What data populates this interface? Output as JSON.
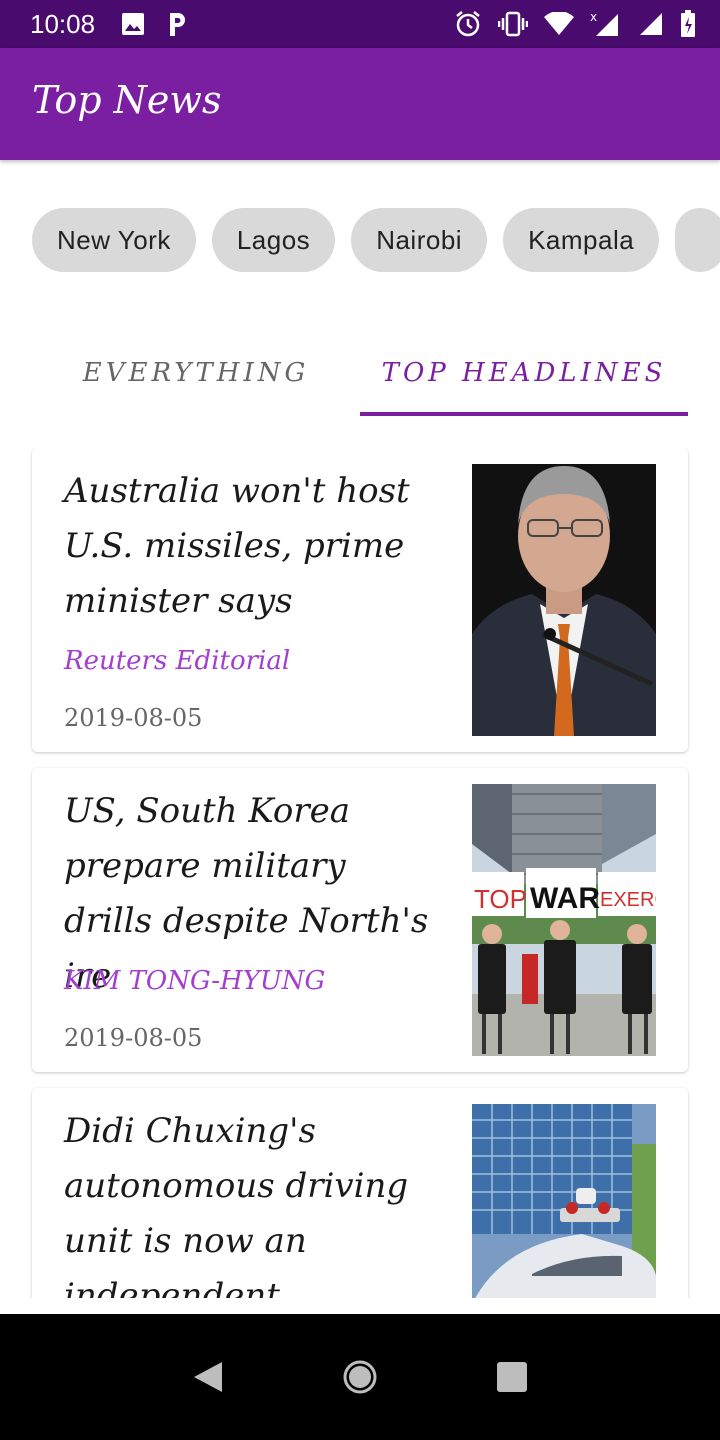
{
  "status_bar": {
    "time": "10:08",
    "left_icons": [
      "image-icon",
      "parking-icon"
    ],
    "right_icons": [
      "alarm-icon",
      "vibrate-icon",
      "wifi-icon",
      "signal-icon",
      "signal-icon",
      "battery-icon"
    ]
  },
  "app_bar": {
    "title": "Top News"
  },
  "chips": [
    "New York",
    "Lagos",
    "Nairobi",
    "Kampala",
    ""
  ],
  "tabs": [
    {
      "label": "EVERYTHING",
      "active": false
    },
    {
      "label": "TOP HEADLINES",
      "active": true
    }
  ],
  "articles": [
    {
      "title": "Australia won't host U.S. missiles, prime minister says",
      "author": "Reuters Editorial",
      "date": "2019-08-05"
    },
    {
      "title": "US, South Korea prepare military drills despite North's ire",
      "author": "KIM TONG-HYUNG",
      "date": "2019-08-05",
      "image_signs": [
        "TOP",
        "WAR",
        "EXERCI"
      ]
    },
    {
      "title": "Didi Chuxing's autonomous driving unit is now an independent company",
      "author": "",
      "date": ""
    }
  ],
  "nav_bar": {
    "icons": [
      "back-icon",
      "home-icon",
      "recents-icon"
    ]
  },
  "colors": {
    "primary": "#7b1fa2",
    "primary_dark": "#4a0b6e",
    "accent": "#a33ed1"
  }
}
